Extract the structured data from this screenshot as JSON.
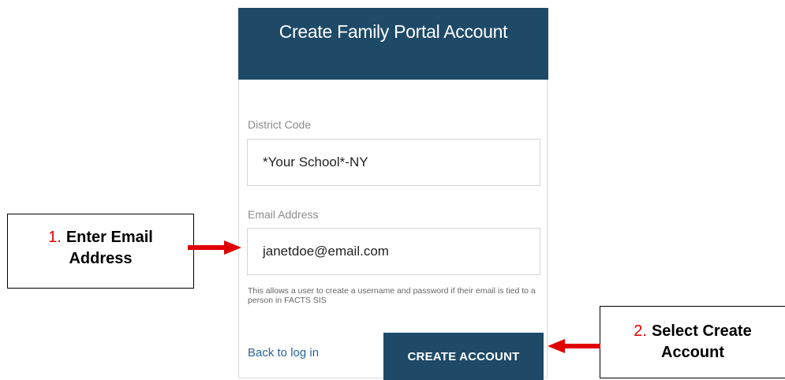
{
  "form": {
    "title": "Create Family Portal Account",
    "district_code_label": "District Code",
    "district_code_value": "*Your School*-NY",
    "email_label": "Email Address",
    "email_value": "janetdoe@email.com",
    "help_text": "This allows a user to create a username and password if their email is tied to a person in FACTS SIS",
    "back_link": "Back to log in",
    "create_button": "CREATE ACCOUNT"
  },
  "callouts": [
    {
      "number": "1.",
      "line1": "Enter Email",
      "line2": "Address"
    },
    {
      "number": "2.",
      "line1": "Select Create",
      "line2": "Account"
    }
  ],
  "colors": {
    "header": "#1e4a68",
    "button": "#1e4a68",
    "arrow": "#e00000",
    "link": "#2a6496"
  }
}
